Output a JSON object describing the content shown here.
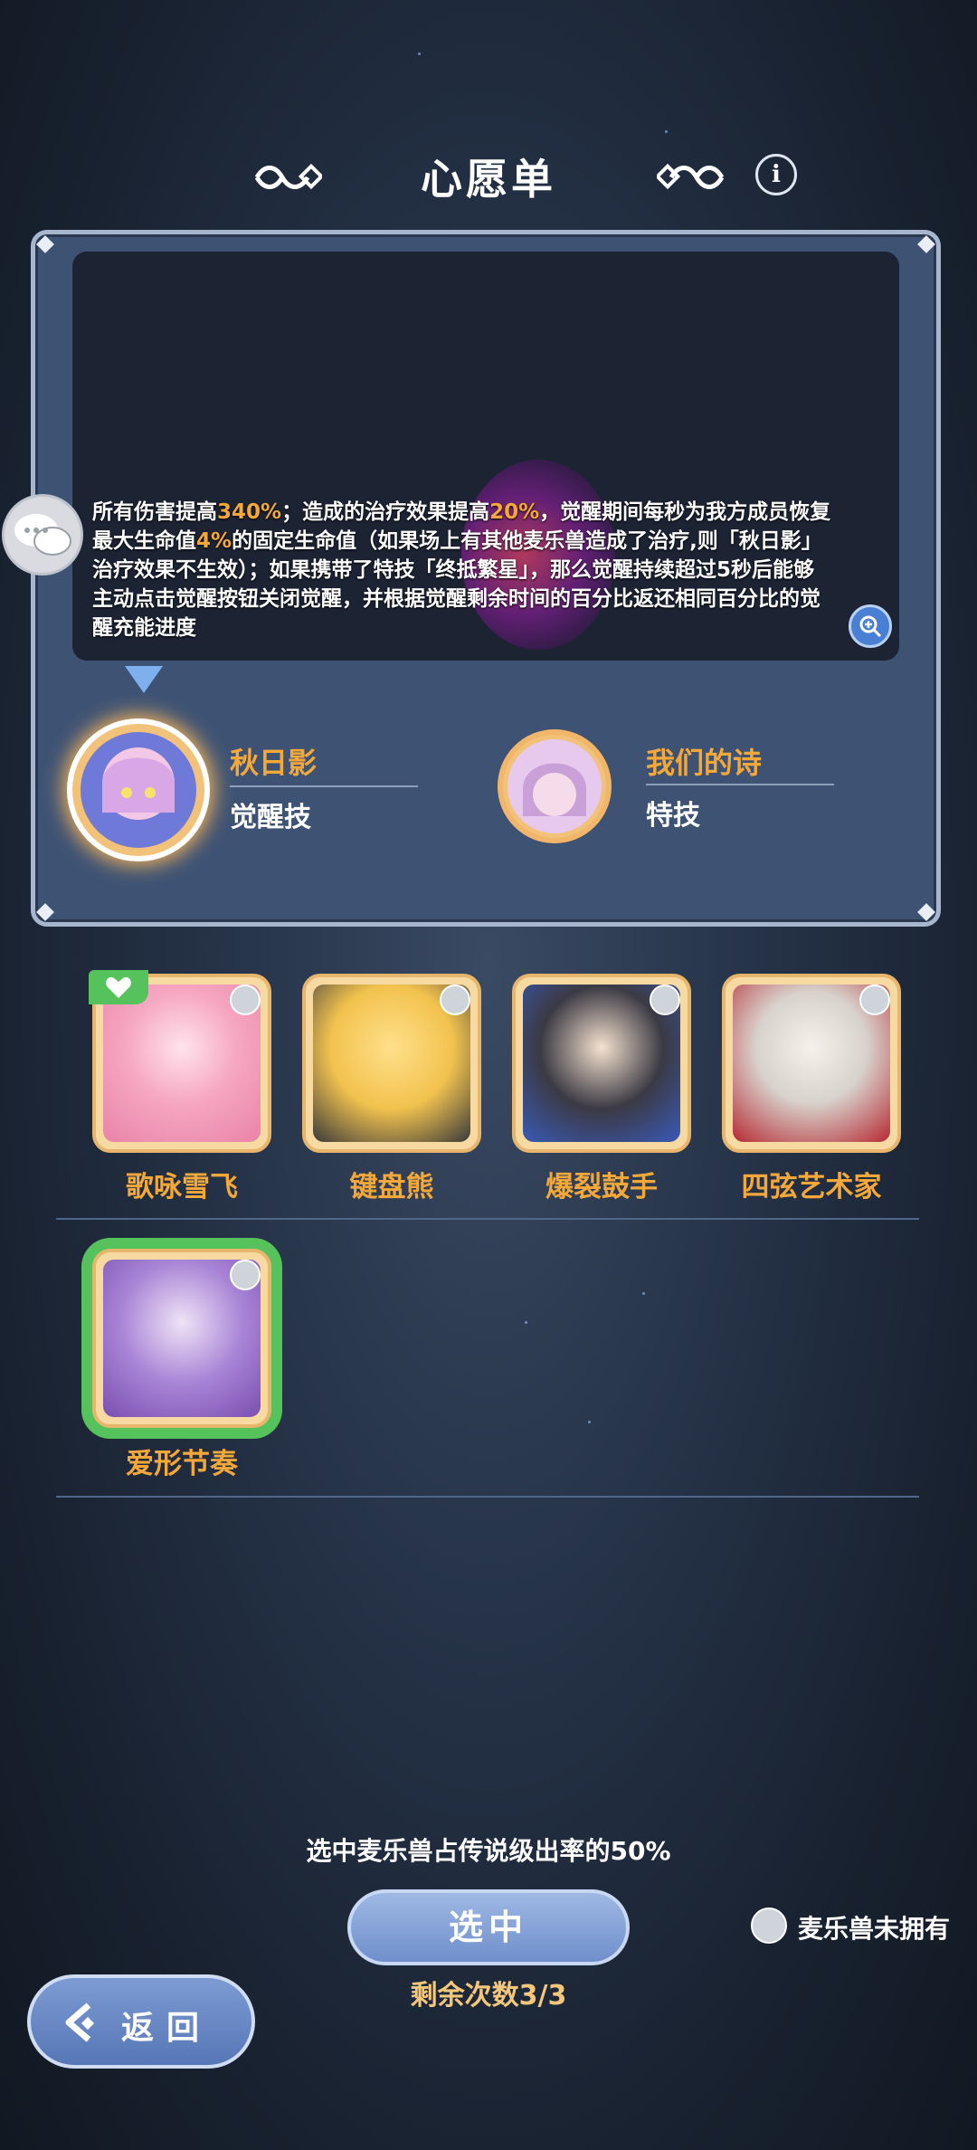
{
  "header": {
    "title": "心愿单",
    "info_icon": "info-icon",
    "ornament_icon": "knot-ornament-icon"
  },
  "skill_description": {
    "segments": [
      {
        "text": "所有伤害提高",
        "highlight": false
      },
      {
        "text": "340%",
        "highlight": true
      },
      {
        "text": "；造成的治疗效果提高",
        "highlight": false
      },
      {
        "text": "20%",
        "highlight": true
      },
      {
        "text": "，觉醒期间每秒为我方成员恢复最大生命值",
        "highlight": false
      },
      {
        "text": "4%",
        "highlight": true
      },
      {
        "text": "的固定生命值（如果场上有其他麦乐兽造成了治疗,则「秋日影」治疗效果不生效）；如果携带了特技「终抵繁星」，那么觉醒持续超过5秒后能够主动点击觉醒按钮关闭觉醒，并根据觉醒剩余时间的百分比返还相同百分比的觉醒充能进度",
        "highlight": false
      }
    ],
    "highlight_color": "#f5a83a",
    "zoom_icon": "zoom-in-icon",
    "chat_icon": "chat-bubbles-icon"
  },
  "skills": [
    {
      "name": "秋日影",
      "type": "觉醒技",
      "selected": true
    },
    {
      "name": "我们的诗",
      "type": "特技",
      "selected": false
    }
  ],
  "characters": [
    {
      "name": "歌咏雪飞",
      "favorite": true,
      "selected": false
    },
    {
      "name": "键盘熊",
      "favorite": false,
      "selected": false
    },
    {
      "name": "爆裂鼓手",
      "favorite": false,
      "selected": false
    },
    {
      "name": "四弦艺术家",
      "favorite": false,
      "selected": false
    },
    {
      "name": "爱形节奏",
      "favorite": false,
      "selected": true
    }
  ],
  "footer": {
    "rate_text": "选中麦乐兽占传说级出率的50%",
    "select_label": "选中",
    "remaining_text": "剩余次数3/3",
    "not_owned_label": "麦乐兽未拥有",
    "back_label": "返回"
  },
  "colors": {
    "accent_orange": "#f5a83a",
    "selected_green": "#56c25c",
    "button_blue": "#6f8ecb"
  }
}
